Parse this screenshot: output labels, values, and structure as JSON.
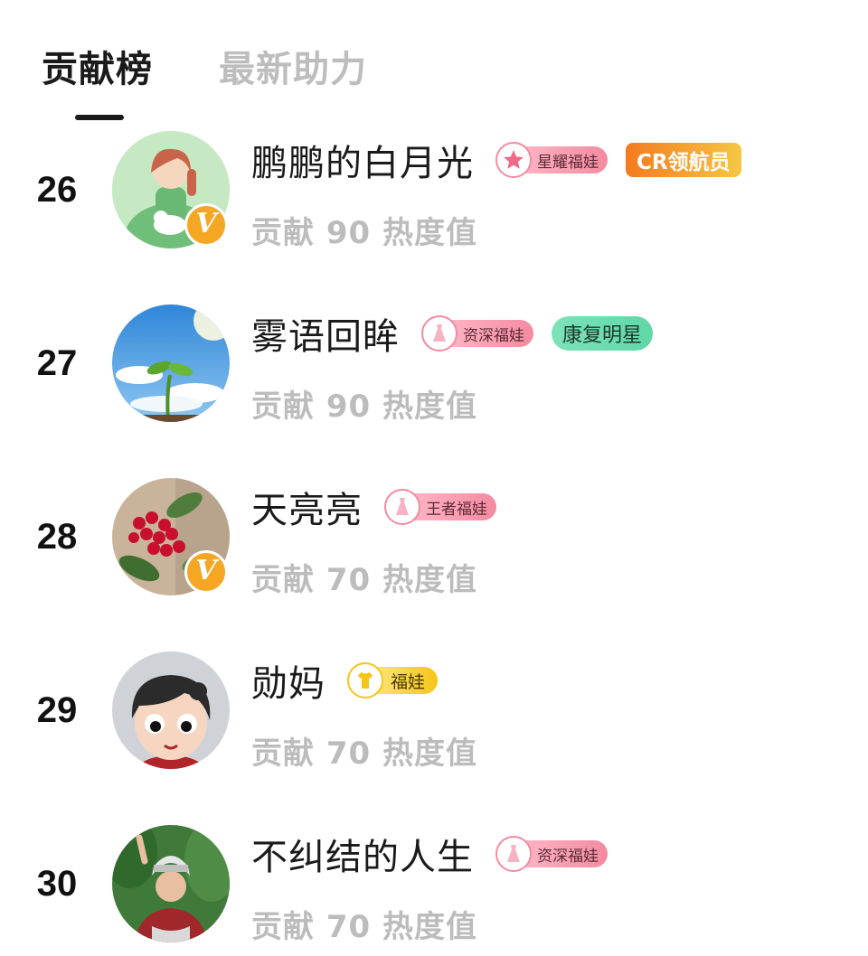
{
  "tabs": [
    {
      "label": "贡献榜",
      "active": true
    },
    {
      "label": "最新助力",
      "active": false
    }
  ],
  "verified_mark": "V",
  "rows": [
    {
      "rank": "26",
      "name": "鹏鹏的白月光",
      "avatar_icon": "woman-with-cat-illustration",
      "verified": true,
      "badge": {
        "label": "星耀福娃",
        "icon": "star-icon",
        "style": "pink"
      },
      "tag": {
        "label": "CR领航员",
        "style": "orange"
      },
      "score": "贡献 90 热度值"
    },
    {
      "rank": "27",
      "name": "雾语回眸",
      "avatar_icon": "sprout-sky-photo",
      "verified": false,
      "badge": {
        "label": "资深福娃",
        "icon": "dress-icon",
        "style": "pink"
      },
      "tag": {
        "label": "康复明星",
        "style": "green"
      },
      "score": "贡献 90 热度值"
    },
    {
      "rank": "28",
      "name": "天亮亮",
      "avatar_icon": "red-berries-photo",
      "verified": true,
      "badge": {
        "label": "王者福娃",
        "icon": "dress-icon",
        "style": "pink"
      },
      "tag": null,
      "score": "贡献 70 热度值"
    },
    {
      "rank": "29",
      "name": "勋妈",
      "avatar_icon": "cartoon-girl-avatar",
      "verified": false,
      "badge": {
        "label": "福娃",
        "icon": "tshirt-icon",
        "style": "yellow"
      },
      "tag": null,
      "score": "贡献 70 热度值"
    },
    {
      "rank": "30",
      "name": "不纠结的人生",
      "avatar_icon": "woman-traditional-costume-photo",
      "verified": false,
      "badge": {
        "label": "资深福娃",
        "icon": "dress-icon",
        "style": "pink"
      },
      "tag": null,
      "score": "贡献 70 热度值"
    }
  ],
  "colors": {
    "active_tab": "#1a1a1a",
    "inactive_tab": "#bdbdbd",
    "score_text": "#bcbcbc",
    "verified_badge": "#f5a623",
    "pink_badge": "#f48aa0",
    "yellow_badge": "#f5c518",
    "cr_tag": "#f47b1e",
    "green_tag": "#6fddb0"
  }
}
